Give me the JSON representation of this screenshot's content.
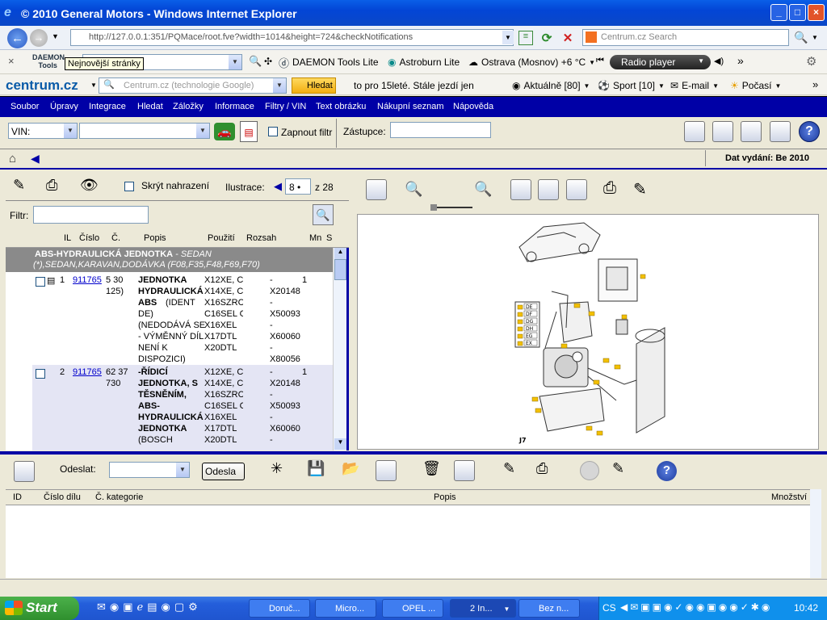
{
  "window": {
    "title": "© 2010 General Motors - Windows Internet Explorer"
  },
  "browser": {
    "address": "http://127.0.0.1:351/PQMace/root.fve?width=1014&height=724&checkNotifications",
    "search_placeholder": "Centrum.cz Search",
    "tooltip": "Nejnovější stránky",
    "toolbar1": {
      "daemon": "DAEMON Tools Lite",
      "astroburn": "Astroburn Lite",
      "weather": "Ostrava (Mosnov) +6 °C",
      "radio": "Radio player"
    },
    "toolbar2": {
      "logo": "centrum.cz",
      "search_placeholder": "Centrum.cz (technologie Google)",
      "hledat": "Hledat",
      "ticker": "to pro 15leté. Stále jezdí jen",
      "aktualne": "Aktuálně [80]",
      "sport": "Sport [10]",
      "email": "E-mail",
      "pocasi": "Počasí"
    }
  },
  "app": {
    "menu": [
      "Soubor",
      "Úpravy",
      "Integrace",
      "Hledat",
      "Záložky",
      "Informace",
      "Filtry / VIN",
      "Text obrázku",
      "Nákupní seznam",
      "Nápověda"
    ],
    "vin_label": "VIN:",
    "filter_toggle": "Zapnout filtr",
    "zastupce_label": "Zástupce:",
    "release": "Dat vydání: Be 2010",
    "left": {
      "hide_replaced": "Skrýt nahrazení",
      "illustration_label": "Ilustrace:",
      "illustration_num": "8",
      "illustration_total": "z 28",
      "filter_label": "Filtr:",
      "columns": [
        "IL",
        "Číslo",
        "Č.",
        "Popis",
        "Použití",
        "Rozsah",
        "Mn",
        "S"
      ],
      "group_title": "ABS-HYDRAULICKÁ JEDNOTKA",
      "group_sub": " - SEDAN",
      "group_line2": "(*),SEDAN,KARAVAN,DODÁVKA (F08,F35,F48,F69,F70)",
      "rows": [
        {
          "il": "1",
          "cislo": "911765",
          "c": "5 30\n125)",
          "popis_bold": "JEDNOTKA\nHYDRAULICKÁ\nABS",
          "popis_rest": "(IDENT\nDE)\n(NEDODÁVÁ SE\n- VÝMĚNNÝ DÍL\nNENÍ K\nDISPOZICI)",
          "pouziti": "X12XE, C\nX14XE, C\nX16SZRC\nC16SEL C\nX16XEL\nX17DTL\nX20DTL",
          "rozsah": "-\nX20148\n-\nX50093\n-\nX60060\n-\nX80056",
          "mn": "1"
        },
        {
          "il": "2",
          "cislo": "911765",
          "c": "62 37\n730",
          "popis_bold": "-ŘÍDICÍ\nJEDNOTKA, S\nTĚSNĚNÍM,\nABS-\nHYDRAULICKÁ\nJEDNOTKA",
          "popis_rest": "(BOSCH",
          "pouziti": "X12XE, C\nX14XE, C\nX16SZRC\nC16SEL C\nX16XEL\nX17DTL\nX20DTL",
          "rozsah": "-\nX20148\n-\nX50093\n-\nX60060\n-",
          "mn": "1"
        }
      ]
    },
    "diagram": {
      "ref": "J7",
      "chips": [
        "DE",
        "DF",
        "DG",
        "DH",
        "EG",
        "EX"
      ]
    },
    "bottom": {
      "send_label": "Odeslat:",
      "send_button": "Odesla",
      "columns": [
        "ID",
        "Číslo dílu",
        "Č. kategorie",
        "Popis",
        "Množství"
      ]
    }
  },
  "taskbar": {
    "start": "Start",
    "tasks": [
      "Doruč...",
      "Micro...",
      "OPEL ...",
      "2 In...",
      "Bez n..."
    ],
    "lang": "CS",
    "clock": "10:42"
  },
  "colors": {
    "menu_bg": "#0000a6",
    "group_bg": "#8a8a8a",
    "link": "#0000cc"
  }
}
